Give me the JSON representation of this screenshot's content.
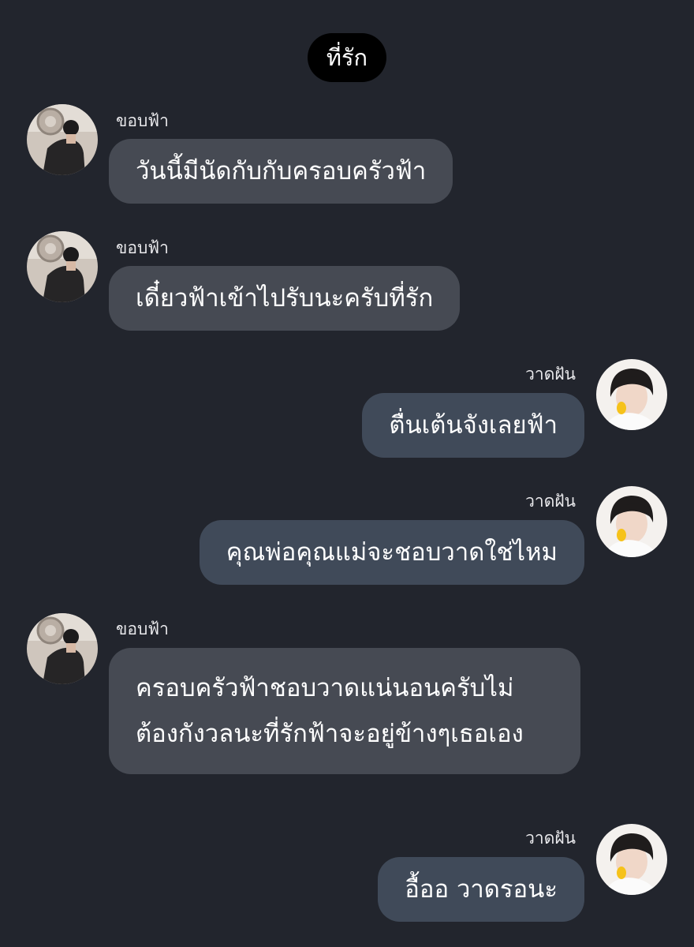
{
  "chat": {
    "title": "ที่รัก"
  },
  "messages": [
    {
      "sender": "ขอบฟ้า",
      "side": "in",
      "text": "วันนี้มีนัดกับกับครอบครัวฟ้า",
      "avatar": "boyfriend-avatar"
    },
    {
      "sender": "ขอบฟ้า",
      "side": "in",
      "text": "เดี๋ยวฟ้าเข้าไปรับนะครับที่รัก",
      "avatar": "boyfriend-avatar"
    },
    {
      "sender": "วาดฝัน",
      "side": "out",
      "text": "ตื่นเต้นจังเลยฟ้า",
      "avatar": "user-avatar"
    },
    {
      "sender": "วาดฝัน",
      "side": "out",
      "text": "คุณพ่อคุณแม่จะชอบวาดใช่ไหม",
      "avatar": "user-avatar"
    },
    {
      "sender": "ขอบฟ้า",
      "side": "in",
      "text": "ครอบครัวฟ้าชอบวาดแน่นอนครับไม่ต้องกังวลนะที่รักฟ้าจะอยู่ข้างๆเธอเอง",
      "avatar": "boyfriend-avatar"
    },
    {
      "sender": "วาดฝัน",
      "side": "out",
      "text": "อื้ออ วาดรอนะ",
      "avatar": "user-avatar"
    }
  ],
  "colors": {
    "background": "#22252d",
    "header_pill": "#000000",
    "bubble_incoming": "#464a53",
    "bubble_outgoing": "#404a59",
    "text": "#ffffff"
  }
}
